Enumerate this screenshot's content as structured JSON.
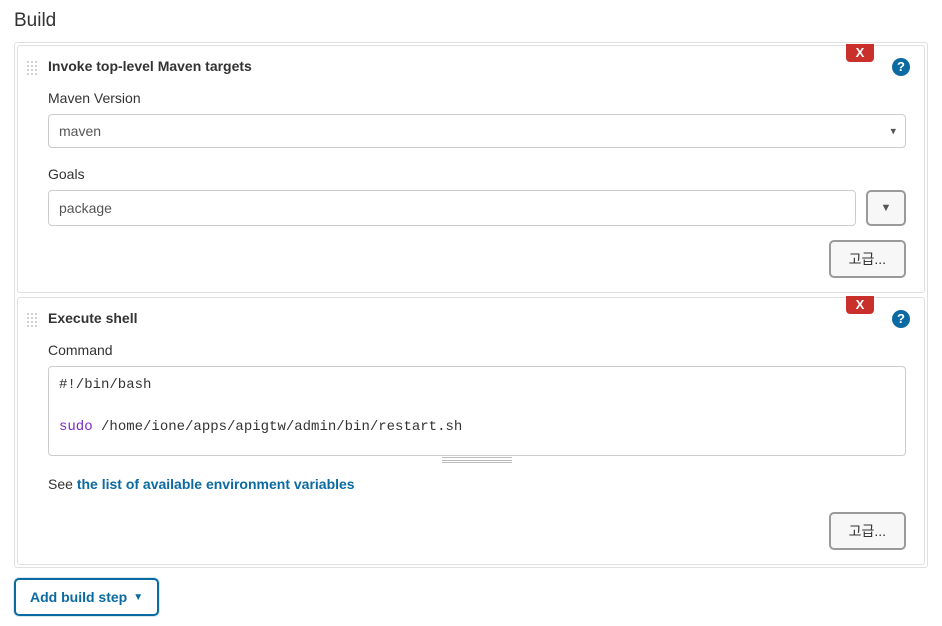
{
  "section_title": "Build",
  "steps": {
    "maven": {
      "title": "Invoke top-level Maven targets",
      "delete_label": "X",
      "help_label": "?",
      "version_label": "Maven Version",
      "version_value": "maven",
      "goals_label": "Goals",
      "goals_value": "package",
      "dropdown_icon": "▼",
      "advanced_label": "고급..."
    },
    "shell": {
      "title": "Execute shell",
      "delete_label": "X",
      "help_label": "?",
      "command_label": "Command",
      "command_line1": "#!/bin/bash",
      "command_sudo": "sudo",
      "command_rest": " /home/ione/apps/apigtw/admin/bin/restart.sh",
      "env_prefix": "See ",
      "env_link": "the list of available environment variables",
      "advanced_label": "고급..."
    }
  },
  "add_step_label": "Add build step",
  "add_step_caret": "▼"
}
